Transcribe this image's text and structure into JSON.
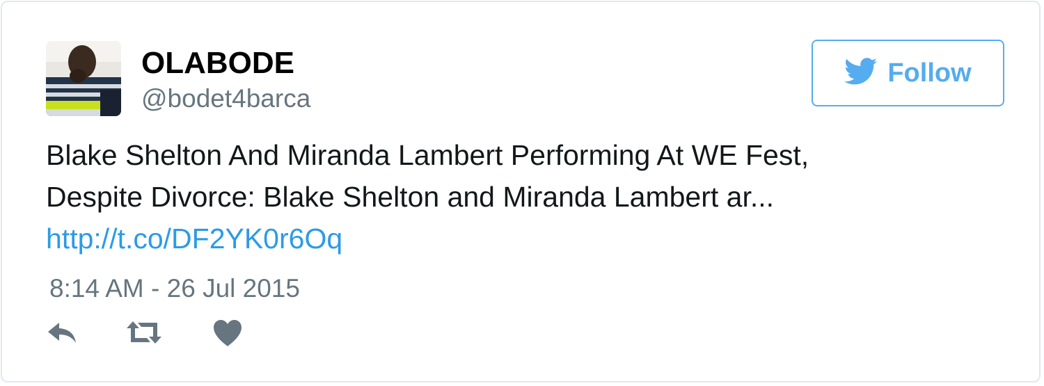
{
  "tweet": {
    "display_name": "OLABODE",
    "handle": "@bodet4barca",
    "text_line1": "Blake Shelton And Miranda Lambert Performing At WE Fest,",
    "text_line2": "Despite Divorce: Blake Shelton and Miranda Lambert ar...",
    "link": "http://t.co/DF2YK0r6Oq",
    "timestamp": "8:14 AM - 26 Jul 2015"
  },
  "follow_button": {
    "label": "Follow",
    "icon": "twitter-bird-icon"
  },
  "actions": [
    {
      "icon": "reply-icon"
    },
    {
      "icon": "retweet-icon"
    },
    {
      "icon": "like-heart-icon"
    }
  ],
  "colors": {
    "accent": "#55acee",
    "link": "#2b9be6",
    "secondary_text": "#66757f",
    "border": "#e1e8ed",
    "action_icon": "#66757f"
  }
}
